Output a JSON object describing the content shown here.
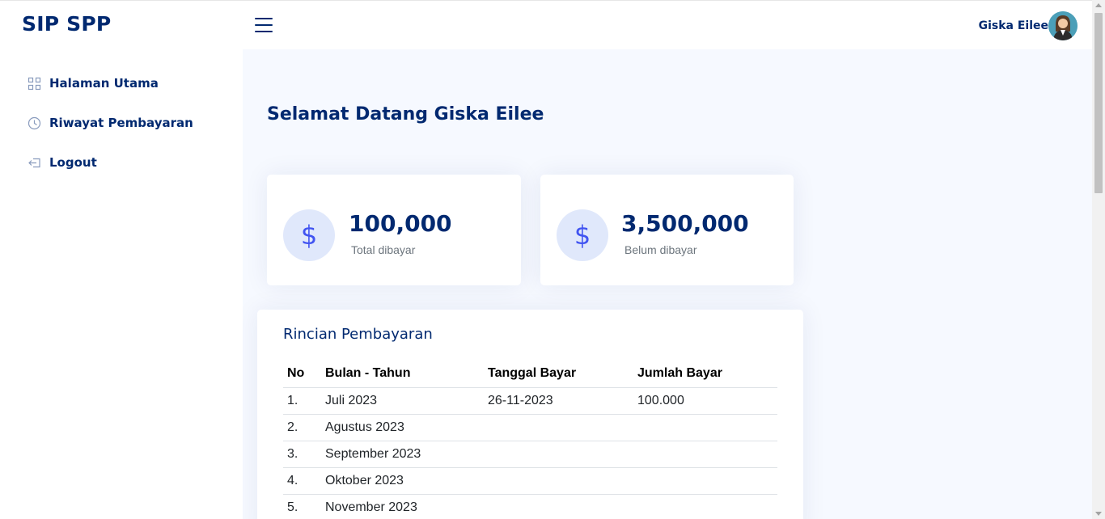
{
  "app": {
    "title": "SIP SPP"
  },
  "header": {
    "user_name": "Giska Eilee"
  },
  "sidebar": {
    "items": [
      {
        "label": "Halaman Utama",
        "icon": "grid-icon"
      },
      {
        "label": "Riwayat Pembayaran",
        "icon": "clock-icon"
      },
      {
        "label": "Logout",
        "icon": "logout-icon"
      }
    ]
  },
  "main": {
    "welcome": "Selamat Datang Giska Eilee",
    "cards": [
      {
        "value": "100,000",
        "label": "Total dibayar",
        "icon": "dollar-icon"
      },
      {
        "value": "3,500,000",
        "label": "Belum dibayar",
        "icon": "dollar-icon"
      }
    ],
    "payment_table": {
      "title": "Rincian Pembayaran",
      "headers": [
        "No",
        "Bulan - Tahun",
        "Tanggal Bayar",
        "Jumlah Bayar"
      ],
      "rows": [
        [
          "1.",
          "Juli 2023",
          "26-11-2023",
          "100.000"
        ],
        [
          "2.",
          "Agustus 2023",
          "",
          ""
        ],
        [
          "3.",
          "September 2023",
          "",
          ""
        ],
        [
          "4.",
          "Oktober 2023",
          "",
          ""
        ],
        [
          "5.",
          "November 2023",
          "",
          ""
        ]
      ]
    }
  },
  "colors": {
    "brand": "#012970",
    "accent": "#4154f1",
    "background": "#f6f9ff"
  }
}
